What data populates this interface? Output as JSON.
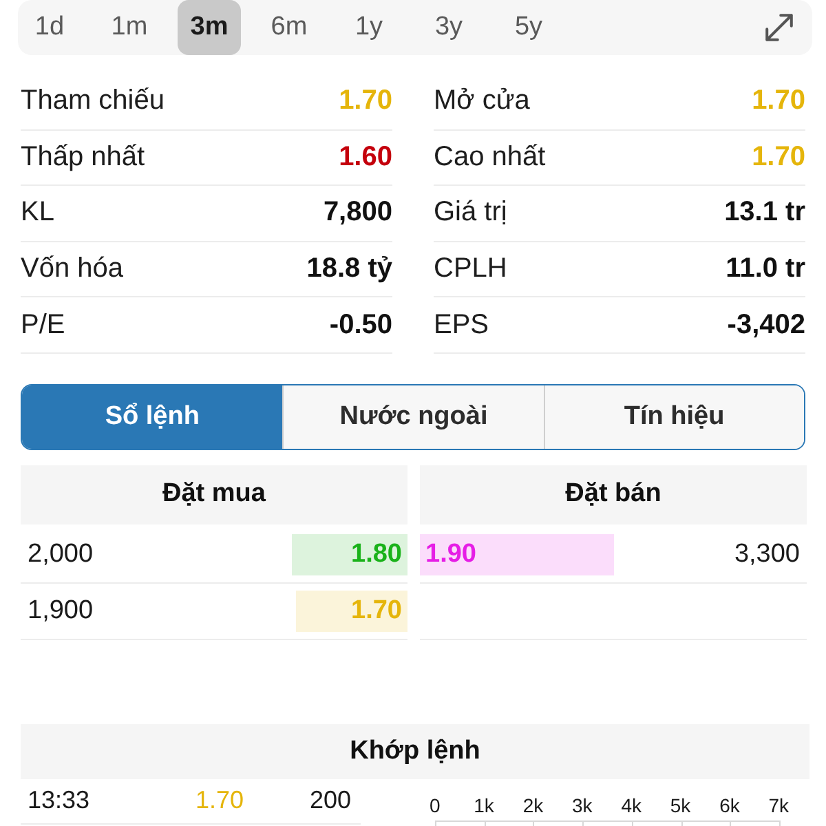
{
  "period_tabs": [
    {
      "label": "1d",
      "selected": false
    },
    {
      "label": "1m",
      "selected": false
    },
    {
      "label": "3m",
      "selected": true
    },
    {
      "label": "6m",
      "selected": false
    },
    {
      "label": "1y",
      "selected": false
    },
    {
      "label": "3y",
      "selected": false
    },
    {
      "label": "5y",
      "selected": false
    }
  ],
  "stats_left": [
    {
      "label": "Tham chiếu",
      "value": "1.70",
      "color": "#e5b50b"
    },
    {
      "label": "Thấp nhất",
      "value": "1.60",
      "color": "#c4000c"
    },
    {
      "label": "KL",
      "value": "7,800"
    },
    {
      "label": "Vốn hóa",
      "value": "18.8 tỷ"
    },
    {
      "label": "P/E",
      "value": "-0.50"
    }
  ],
  "stats_right": [
    {
      "label": "Mở cửa",
      "value": "1.70",
      "color": "#e5b50b"
    },
    {
      "label": "Cao nhất",
      "value": "1.70",
      "color": "#e5b50b"
    },
    {
      "label": "Giá trị",
      "value": "13.1 tr"
    },
    {
      "label": "CPLH",
      "value": "11.0 tr"
    },
    {
      "label": "EPS",
      "value": "-3,402"
    }
  ],
  "section_tabs": [
    {
      "label": "Sổ lệnh",
      "selected": true
    },
    {
      "label": "Nước ngoài",
      "selected": false
    },
    {
      "label": "Tín hiệu",
      "selected": false
    }
  ],
  "order_book": {
    "bid_title": "Đặt mua",
    "ask_title": "Đặt bán",
    "bids": [
      {
        "volume": "2,000",
        "price": "1.80",
        "color": "#1ab21a",
        "level": 0.3
      },
      {
        "volume": "1,900",
        "price": "1.70",
        "color": "#e5b50b",
        "level": 0.29
      }
    ],
    "asks": [
      {
        "price": "1.90",
        "volume": "3,300",
        "color": "#e61ee6",
        "level": 0.5
      }
    ]
  },
  "matched_orders": {
    "title": "Khớp lệnh",
    "trades": [
      {
        "time": "13:33",
        "price": "1.70",
        "color": "#e5b50b",
        "volume": "200"
      }
    ],
    "volume_axis": [
      "0",
      "1k",
      "2k",
      "3k",
      "4k",
      "5k",
      "6k",
      "7k"
    ]
  }
}
